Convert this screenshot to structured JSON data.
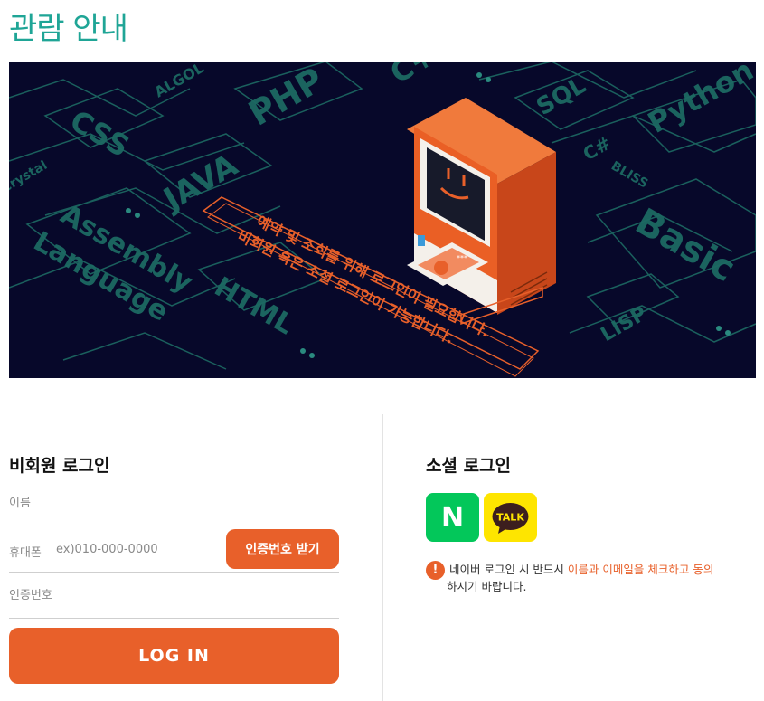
{
  "page": {
    "title": "관람 안내"
  },
  "banner": {
    "message_line1": "예약 및 조회를 위해 로그인이 필요합니다.",
    "message_line2": "비회원 혹은 소셜 로그인이 가능합니다.",
    "languages": [
      "CSS",
      "ALGOL",
      "PHP",
      "C++",
      "SQL",
      "Python",
      "C#",
      "BLISS",
      "Basic",
      "JAVA",
      "Crystal",
      "Assembly",
      "Language",
      "HTML",
      "LISP"
    ],
    "card_text": "***"
  },
  "guest_login": {
    "title": "비회원 로그인",
    "name_placeholder": "이름",
    "phone_label": "휴대폰",
    "phone_placeholder": "ex)010-000-0000",
    "verify_button": "인증번호 받기",
    "code_placeholder": "인증번호",
    "login_button": "LOG IN"
  },
  "social_login": {
    "title": "소셜 로그인",
    "naver_label": "N",
    "kakao_label": "TALK",
    "notice_prefix": "네이버 로그인 시 반드시 ",
    "notice_highlight": "이름과 이메일을 체크하고 동의",
    "notice_suffix": "하시기 바랍니다.",
    "notice_icon": "!"
  },
  "colors": {
    "accent": "#e8602a",
    "title": "#1fa596",
    "banner_bg": "#07082a",
    "naver": "#03c75a",
    "kakao": "#fee500"
  }
}
